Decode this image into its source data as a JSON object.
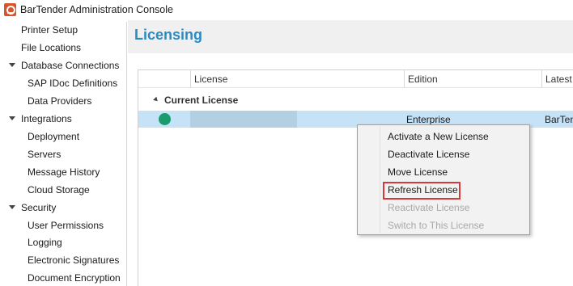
{
  "window": {
    "title": "BarTender Administration Console",
    "icon": "bartender-app-icon"
  },
  "sidebar": {
    "items": [
      {
        "label": "Printer Setup",
        "level": 0,
        "expandable": false
      },
      {
        "label": "File Locations",
        "level": 0,
        "expandable": false
      },
      {
        "label": "Database Connections",
        "level": 0,
        "expandable": true,
        "expanded": true
      },
      {
        "label": "SAP IDoc Definitions",
        "level": 1,
        "expandable": false
      },
      {
        "label": "Data Providers",
        "level": 1,
        "expandable": false
      },
      {
        "label": "Integrations",
        "level": 0,
        "expandable": true,
        "expanded": true
      },
      {
        "label": "Deployment",
        "level": 1,
        "expandable": false
      },
      {
        "label": "Servers",
        "level": 1,
        "expandable": false
      },
      {
        "label": "Message History",
        "level": 1,
        "expandable": false
      },
      {
        "label": "Cloud Storage",
        "level": 1,
        "expandable": false
      },
      {
        "label": "Security",
        "level": 0,
        "expandable": true,
        "expanded": true
      },
      {
        "label": "User Permissions",
        "level": 1,
        "expandable": false
      },
      {
        "label": "Logging",
        "level": 1,
        "expandable": false
      },
      {
        "label": "Electronic Signatures",
        "level": 1,
        "expandable": false
      },
      {
        "label": "Document Encryption",
        "level": 1,
        "expandable": false
      }
    ]
  },
  "main": {
    "title": "Licensing",
    "grid": {
      "columns": [
        "License",
        "Edition",
        "Latest"
      ],
      "group_label": "Current License",
      "rows": [
        {
          "status": "active",
          "status_color": "#1a9b6e",
          "license": "",
          "edition": "Enterprise",
          "latest": "BarTender"
        }
      ]
    }
  },
  "context_menu": {
    "items": [
      {
        "label": "Activate a New License",
        "enabled": true
      },
      {
        "label": "Deactivate License",
        "enabled": true
      },
      {
        "label": "Move License",
        "enabled": true
      },
      {
        "label": "Refresh License",
        "enabled": true,
        "highlighted": true
      },
      {
        "label": "Reactivate License",
        "enabled": false
      },
      {
        "label": "Switch to This License",
        "enabled": false
      }
    ],
    "highlight_color": "#d9383a"
  },
  "colors": {
    "accent": "#2a8bc4",
    "selection": "#c6e2f6"
  }
}
